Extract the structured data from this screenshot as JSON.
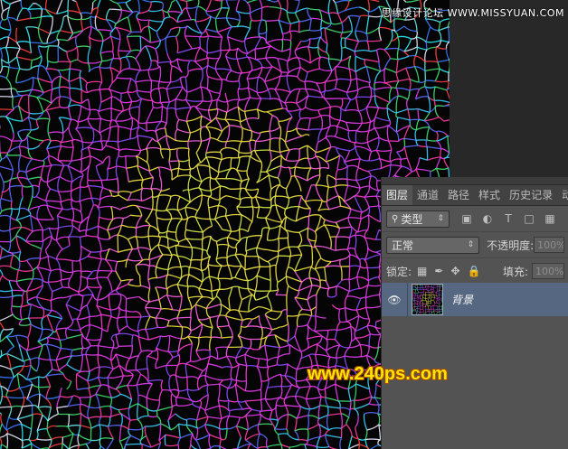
{
  "panel": {
    "tabs": [
      "图层",
      "通道",
      "路径",
      "样式",
      "历史记录",
      "动作"
    ],
    "filter": {
      "label": "类型",
      "icons": [
        "image-icon",
        "adjust-icon",
        "text-icon",
        "shape-icon",
        "smart-icon"
      ]
    },
    "blend_mode": "正常",
    "opacity_label": "不透明度:",
    "opacity_value": "100%",
    "lock_label": "锁定:",
    "fill_label": "填充:",
    "fill_value": "100%",
    "layer": {
      "name": "背景"
    }
  },
  "watermarks": {
    "top": "思缘设计论坛  WWW.MISSYUAN.COM",
    "main": "www.240ps.com"
  },
  "colors": {
    "canvas_bg": "#050505",
    "panel_bg": "#535353",
    "selected_layer": "#566781",
    "watermark_main": "#ffe400"
  }
}
